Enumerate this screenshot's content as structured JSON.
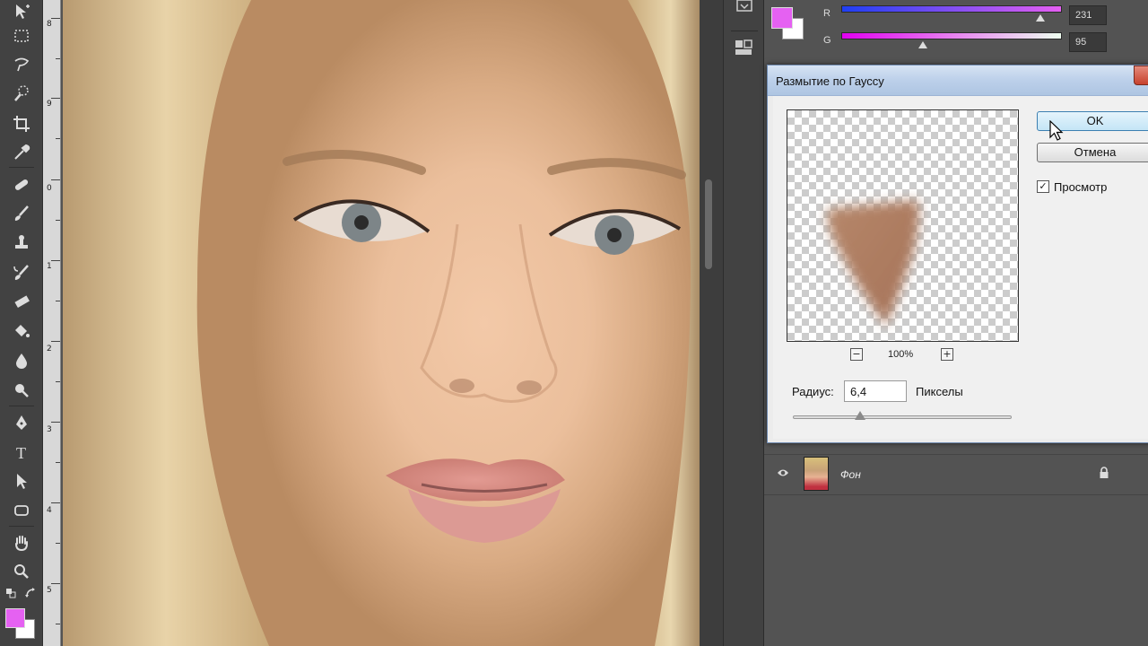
{
  "colors": {
    "foreground": "#e561f2",
    "background": "#ffffff"
  },
  "ruler": {
    "ticks": [
      "8",
      "9",
      "0",
      "1",
      "2",
      "3",
      "4",
      "5"
    ]
  },
  "color_panel": {
    "r_label": "R",
    "r_value": "231",
    "g_label": "G",
    "g_value": "95"
  },
  "dialog": {
    "title": "Размытие по Гауссу",
    "ok_label": "OK",
    "cancel_label": "Отмена",
    "preview_label": "Просмотр",
    "preview_checked": true,
    "zoom_value": "100%",
    "radius_label": "Радиус:",
    "radius_value": "6,4",
    "radius_unit": "Пикселы"
  },
  "layers": {
    "layer_name": "Фон"
  },
  "tools": [
    "move-tool-icon",
    "marquee-tool-icon",
    "lasso-tool-icon",
    "quick-select-icon",
    "crop-tool-icon",
    "eyedropper-icon",
    "healing-brush-icon",
    "brush-tool-icon",
    "clone-stamp-icon",
    "history-brush-icon",
    "eraser-icon",
    "paint-bucket-icon",
    "blur-tool-icon",
    "dodge-tool-icon",
    "pen-tool-icon",
    "type-tool-icon",
    "path-select-icon",
    "shape-tool-icon",
    "hand-tool-icon",
    "zoom-tool-icon"
  ]
}
